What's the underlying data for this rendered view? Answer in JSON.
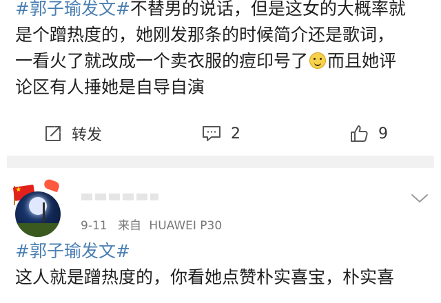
{
  "post": {
    "lines": [
      {
        "hashtag": "#郭子瑜发文#",
        "text": "不替男的说话，但是这女的大概率就"
      },
      {
        "text": "是个蹭热度的，她刚发那条的时候简介还是歌词，"
      },
      {
        "text": "一看火了就改成一个卖衣服的痘印号了",
        "text_after": "而且她评",
        "emoji": "grin-emoji"
      },
      {
        "text": "论区有人捶她是自导自演"
      }
    ]
  },
  "actions": {
    "repost_label": "转发",
    "comment_count": "2",
    "like_count": "9"
  },
  "comment": {
    "timestamp": "9-11",
    "source_prefix": "来自",
    "device": "HUAWEI P30",
    "hashtag": "#郭子瑜发文#",
    "text_line": "这人就是蹭热度的，你看她点赞朴实喜宝，朴实喜"
  },
  "colors": {
    "hashtag": "#4a7fb3",
    "text": "#1f1f1f",
    "meta": "#777777",
    "divider": "#f1f1f1"
  },
  "icons": {
    "repost": "share-square-arrow-icon",
    "comment": "comment-bubble-icon",
    "like": "thumbs-up-icon",
    "more": "chevron-down-icon"
  }
}
